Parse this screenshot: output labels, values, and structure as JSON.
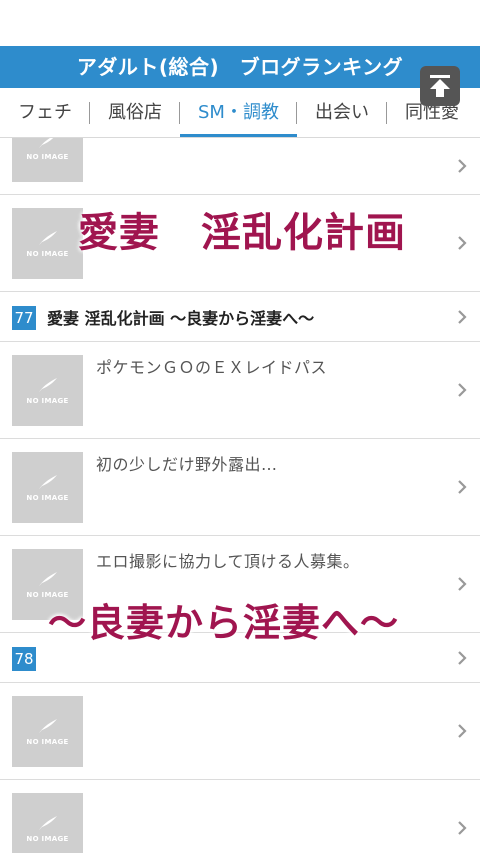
{
  "header": {
    "title": "アダルト(総合)　ブログランキング"
  },
  "tabs": [
    {
      "label": "フェチ",
      "active": false
    },
    {
      "label": "風俗店",
      "active": false
    },
    {
      "label": "SM・調教",
      "active": true
    },
    {
      "label": "出会い",
      "active": false
    },
    {
      "label": "同性愛",
      "active": false
    }
  ],
  "thumb_text": "NO IMAGE",
  "rows": [
    {
      "title": ""
    },
    {
      "title": ""
    },
    {
      "rank": "77",
      "blog": "愛妻 淫乱化計画 〜良妻から淫妻へ〜"
    },
    {
      "title": "ポケモンＧＯのＥＸレイドパス"
    },
    {
      "title": "初の少しだけ野外露出…"
    },
    {
      "title": "エロ撮影に協力して頂ける人募集。"
    },
    {
      "rank": "78",
      "blog": ""
    },
    {
      "title": ""
    },
    {
      "title": ""
    }
  ],
  "overlay": {
    "top_text": "愛妻　淫乱化計画",
    "bottom_text": "〜良妻から淫妻へ〜"
  },
  "colors": {
    "accent": "#2e8ccc",
    "overlay_text": "#a0154f",
    "thumb_bg": "#cfcfcf"
  }
}
